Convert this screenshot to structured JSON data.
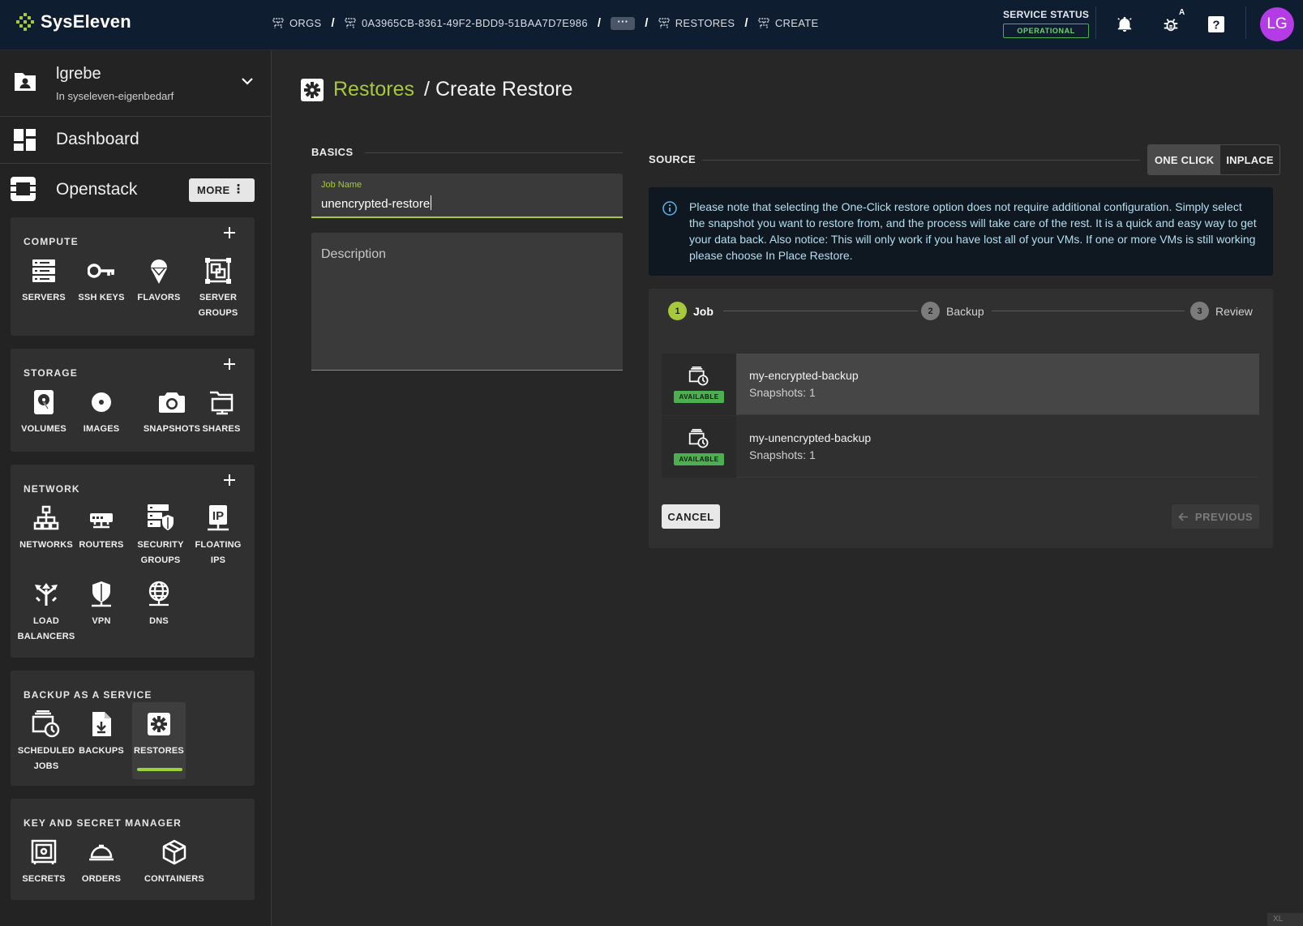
{
  "brand": {
    "name": "SysEleven",
    "accent": "#a6c93b"
  },
  "breadcrumb": [
    {
      "label": "ORGS",
      "icon": "tree-icon"
    },
    {
      "label": "0A3965CB-8361-49F2-BDD9-51BAA7D7E986",
      "icon": "tree-icon"
    },
    {
      "label": "···"
    },
    {
      "label": "RESTORES",
      "icon": "tree-icon"
    },
    {
      "label": "CREATE",
      "icon": "tree-icon"
    }
  ],
  "service_status": {
    "label": "SERVICE STATUS",
    "value": "OPERATIONAL",
    "color": "#4caf50"
  },
  "topbar_icons": [
    "bell-icon",
    "bug-icon",
    "help-icon"
  ],
  "bug_badge": "A",
  "user": {
    "initials": "LG",
    "color": "#b43be6"
  },
  "org": {
    "name": "lgrebe",
    "sub": "In syseleven-eigenbedarf"
  },
  "nav": {
    "dashboard": "Dashboard",
    "openstack": "Openstack",
    "more": "MORE"
  },
  "sections": [
    {
      "title": "COMPUTE",
      "items": [
        {
          "label": "SERVERS",
          "icon": "servers-icon"
        },
        {
          "label": "SSH KEYS",
          "icon": "key-icon"
        },
        {
          "label": "FLAVORS",
          "icon": "ice-cream-icon"
        },
        {
          "label": "SERVER GROUPS",
          "icon": "server-groups-icon"
        }
      ]
    },
    {
      "title": "STORAGE",
      "items": [
        {
          "label": "VOLUMES",
          "icon": "volume-icon"
        },
        {
          "label": "IMAGES",
          "icon": "disc-icon"
        },
        {
          "label": "SNAPSHOTS",
          "icon": "camera-icon"
        },
        {
          "label": "SHARES",
          "icon": "shares-icon"
        }
      ]
    },
    {
      "title": "NETWORK",
      "items": [
        {
          "label": "NETWORKS",
          "icon": "network-icon"
        },
        {
          "label": "ROUTERS",
          "icon": "router-icon"
        },
        {
          "label": "SECURITY GROUPS",
          "icon": "security-groups-icon"
        },
        {
          "label": "FLOATING IPS",
          "icon": "floating-ip-icon"
        },
        {
          "label": "LOAD BALANCERS",
          "icon": "load-balancer-icon"
        },
        {
          "label": "VPN",
          "icon": "vpn-icon"
        },
        {
          "label": "DNS",
          "icon": "globe-icon"
        }
      ]
    },
    {
      "title": "BACKUP AS A SERVICE",
      "items": [
        {
          "label": "SCHEDULED JOBS",
          "icon": "scheduled-jobs-icon"
        },
        {
          "label": "BACKUPS",
          "icon": "backup-download-icon"
        },
        {
          "label": "RESTORES",
          "icon": "gear-icon",
          "active": true
        }
      ]
    },
    {
      "title": "KEY AND SECRET MANAGER",
      "items": [
        {
          "label": "SECRETS",
          "icon": "safe-icon"
        },
        {
          "label": "ORDERS",
          "icon": "service-bell-icon"
        },
        {
          "label": "CONTAINERS",
          "icon": "box-icon"
        }
      ]
    }
  ],
  "page": {
    "title_link": "Restores",
    "title_rest": "/ Create Restore"
  },
  "basics": {
    "heading": "BASICS",
    "job_name_label": "Job Name",
    "job_name_value": "unencrypted-restore",
    "description_placeholder": "Description"
  },
  "source": {
    "heading": "SOURCE",
    "toggle": [
      "ONE CLICK",
      "INPLACE"
    ],
    "toggle_selected": "ONE CLICK",
    "notice": "Please note that selecting the One-Click restore option does not require additional configuration. Simply select the snapshot you want to restore from, and the process will take care of the rest. It is a quick and easy way to get your data back. Also notice: This will only work if you have lost all of your VMs. If one or more VMs is still working please choose In Place Restore."
  },
  "steps": [
    {
      "num": "1",
      "label": "Job",
      "active": true
    },
    {
      "num": "2",
      "label": "Backup"
    },
    {
      "num": "3",
      "label": "Review"
    }
  ],
  "backups": [
    {
      "name": "my-encrypted-backup",
      "snapshots": "Snapshots: 1",
      "status": "AVAILABLE",
      "selected": true
    },
    {
      "name": "my-unencrypted-backup",
      "snapshots": "Snapshots: 1",
      "status": "AVAILABLE"
    }
  ],
  "actions": {
    "cancel": "CANCEL",
    "previous": "PREVIOUS"
  },
  "corner": "XL"
}
